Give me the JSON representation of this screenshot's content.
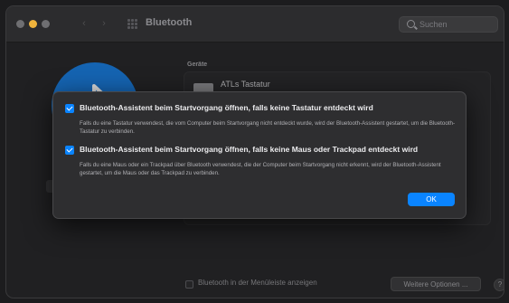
{
  "window": {
    "title": "Bluetooth",
    "search_placeholder": "Suchen"
  },
  "devices": {
    "section_label": "Geräte",
    "items": [
      {
        "name": "ATLs Tastatur",
        "status": ""
      }
    ]
  },
  "dialog": {
    "options": [
      {
        "checked": true,
        "title": "Bluetooth-Assistent beim Startvorgang öffnen, falls keine Tastatur entdeckt wird",
        "description": "Falls du eine Tastatur verwendest, die vom Computer beim Startvorgang nicht entdeckt wurde, wird der Bluetooth-Assistent gestartet, um die Bluetooth-Tastatur zu verbinden."
      },
      {
        "checked": true,
        "title": "Bluetooth-Assistent beim Startvorgang öffnen, falls keine Maus oder Trackpad entdeckt wird",
        "description": "Falls du eine Maus oder ein Trackpad über Bluetooth verwendest, die der Computer beim Startvorgang nicht erkennt, wird der Bluetooth-Assistent gestartet, um die Maus oder das Trackpad zu verbinden."
      }
    ],
    "ok_label": "OK"
  },
  "footer": {
    "menubar_label": "Bluetooth in der Menüleiste anzeigen",
    "more_options_label": "Weitere Optionen ...",
    "help_label": "?"
  },
  "colors": {
    "accent": "#0a84ff",
    "bluetooth_logo": "#1976d2",
    "minimize": "#f0b43c"
  },
  "icons": {
    "bluetooth": "bluetooth-icon",
    "search": "search-icon",
    "grid": "grid-icon",
    "keyboard": "keyboard-icon"
  }
}
